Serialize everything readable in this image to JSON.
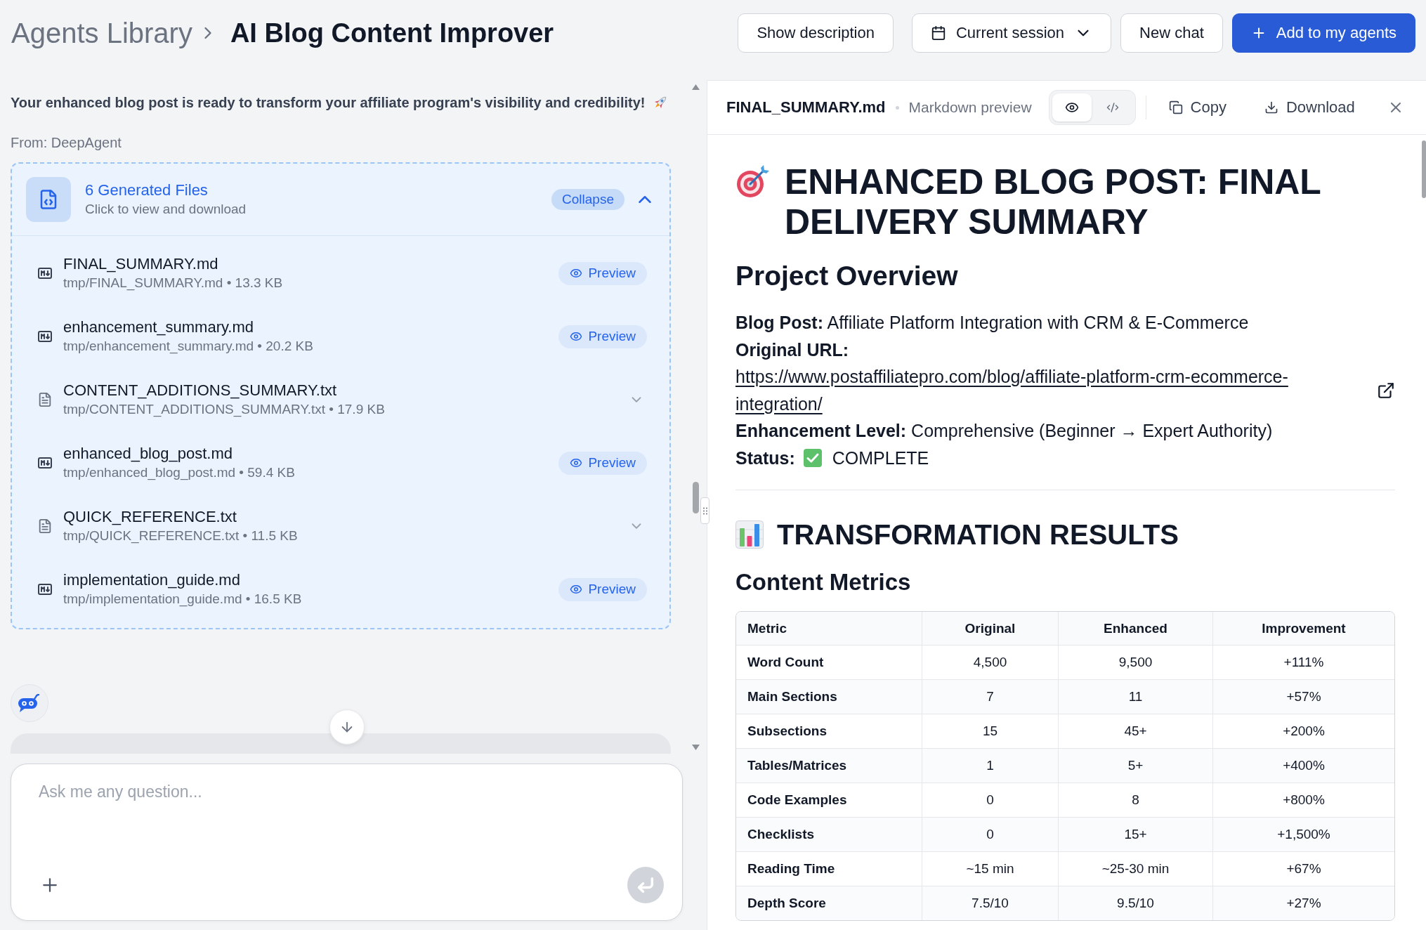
{
  "header": {
    "breadcrumb": "Agents Library",
    "title": "AI Blog Content Improver",
    "buttons": [
      {
        "label": "Show description",
        "kind": "plain"
      },
      {
        "label": "Current session",
        "kind": "dropdown"
      },
      {
        "label": "New chat",
        "kind": "plain"
      },
      {
        "label": "Add to my agents",
        "kind": "primary"
      }
    ]
  },
  "chat": {
    "message": "Your enhanced blog post is ready to transform your affiliate program's visibility and credibility!",
    "sender": "From: DeepAgent",
    "files_card": {
      "title": "6 Generated Files",
      "subtitle": "Click to view and download",
      "toggle": "Collapse",
      "expanded": true,
      "files": [
        {
          "name": "FINAL_SUMMARY.md",
          "detail": "tmp/FINAL_SUMMARY.md • 13.3 KB",
          "kind": "markdown",
          "action": "Preview"
        },
        {
          "name": "enhancement_summary.md",
          "detail": "tmp/enhancement_summary.md • 20.2 KB",
          "kind": "markdown",
          "action": "Preview"
        },
        {
          "name": "CONTENT_ADDITIONS_SUMMARY.txt",
          "detail": "tmp/CONTENT_ADDITIONS_SUMMARY.txt • 17.9 KB",
          "kind": "text"
        },
        {
          "name": "enhanced_blog_post.md",
          "detail": "tmp/enhanced_blog_post.md • 59.4 KB",
          "kind": "markdown",
          "action": "Preview"
        },
        {
          "name": "QUICK_REFERENCE.txt",
          "detail": "tmp/QUICK_REFERENCE.txt • 11.5 KB",
          "kind": "text"
        },
        {
          "name": "implementation_guide.md",
          "detail": "tmp/implementation_guide.md • 16.5 KB",
          "kind": "markdown",
          "action": "Preview"
        }
      ]
    },
    "composer": {
      "placeholder": "Ask me any question..."
    }
  },
  "preview": {
    "file_name": "FINAL_SUMMARY.md",
    "mode_label": "Markdown preview",
    "view_modes": [
      {
        "kind": "preview",
        "selected": true
      },
      {
        "kind": "code",
        "selected": false
      }
    ],
    "actions": [
      {
        "label": "Copy",
        "kind": "copy"
      },
      {
        "label": "Download",
        "kind": "download"
      }
    ],
    "document": {
      "title": "ENHANCED BLOG POST: FINAL DELIVERY SUMMARY",
      "overview_heading": "Project Overview",
      "fields": [
        {
          "kind": "text",
          "label": "Blog Post:",
          "value": "Affiliate Platform Integration with CRM & E-Commerce"
        },
        {
          "kind": "link",
          "label": "Original URL:",
          "value": "https://www.postaffiliatepro.com/blog/affiliate-platform-crm-ecommerce-integration/"
        },
        {
          "kind": "text",
          "label": "Enhancement Level:",
          "value": "Comprehensive (Beginner → Expert Authority)"
        },
        {
          "kind": "status",
          "label": "Status:",
          "value": "COMPLETE"
        }
      ],
      "results_heading": "TRANSFORMATION RESULTS",
      "metrics_heading": "Content Metrics",
      "table": {
        "columns": [
          "Metric",
          "Original",
          "Enhanced",
          "Improvement"
        ],
        "rows": [
          [
            "Word Count",
            "4,500",
            "9,500",
            "+111%"
          ],
          [
            "Main Sections",
            "7",
            "11",
            "+57%"
          ],
          [
            "Subsections",
            "15",
            "45+",
            "+200%"
          ],
          [
            "Tables/Matrices",
            "1",
            "5+",
            "+400%"
          ],
          [
            "Code Examples",
            "0",
            "8",
            "+800%"
          ],
          [
            "Checklists",
            "0",
            "15+",
            "+1,500%"
          ],
          [
            "Reading Time",
            "~15 min",
            "~25-30 min",
            "+67%"
          ],
          [
            "Depth Score",
            "7.5/10",
            "9.5/10",
            "+27%"
          ]
        ]
      }
    }
  }
}
